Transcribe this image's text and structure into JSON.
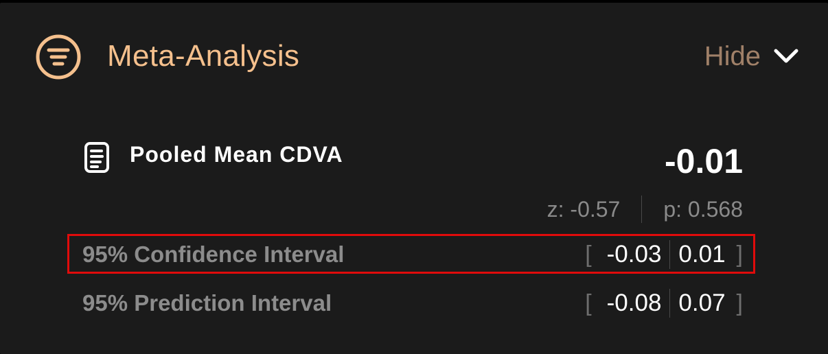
{
  "colors": {
    "accent": "#f5c08d",
    "hide_text": "#a08068",
    "panel_bg": "#1b1b1b",
    "highlight_border": "#e00b0b"
  },
  "header": {
    "icon": "filter-lines-circle-icon",
    "title": "Meta-Analysis",
    "toggle_label": "Hide",
    "toggle_icon": "chevron-down-icon"
  },
  "pooled": {
    "icon": "document-icon",
    "label": "Pooled Mean CDVA",
    "value": "-0.01",
    "z": "z: -0.57",
    "p": "p: 0.568"
  },
  "intervals": [
    {
      "label": "95% Confidence Interval",
      "open_bracket": "[",
      "lower": "-0.03",
      "upper": "0.01",
      "close_bracket": "]",
      "highlighted": true
    },
    {
      "label": "95% Prediction Interval",
      "open_bracket": "[",
      "lower": "-0.08",
      "upper": "0.07",
      "close_bracket": "]",
      "highlighted": false
    }
  ]
}
